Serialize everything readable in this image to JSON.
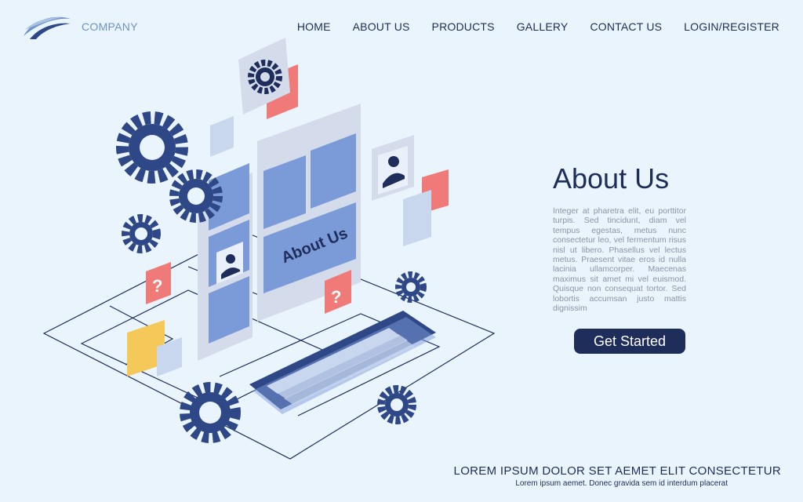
{
  "brand": {
    "name": "COMPANY",
    "logo_icon": "wave-logo-icon"
  },
  "nav": {
    "items": [
      {
        "label": "HOME"
      },
      {
        "label": "ABOUT US"
      },
      {
        "label": "PRODUCTS"
      },
      {
        "label": "GALLERY"
      },
      {
        "label": "CONTACT US"
      },
      {
        "label": "LOGIN/REGISTER"
      }
    ]
  },
  "illustration": {
    "label": "About Us",
    "icons": [
      "gear-icon",
      "user-icon",
      "question-icon",
      "keyboard-icon"
    ]
  },
  "hero": {
    "title": "About Us",
    "body": "Integer at pharetra elit, eu porttitor turpis. Sed tincidunt, diam vel tempus egestas, metus nunc consectetur leo, vel fermentum risus nisl ut libero. Phasellus vel lectus metus. Praesent vitae eros id nulla lacinia ullamcorper. Maecenas maximus sit amet mi vel euismod. Quisque non consequat tortor. Sed lobortis accumsan justo mattis dignissim",
    "cta_label": "Get Started"
  },
  "footer": {
    "heading": "LOREM IPSUM DOLOR SET AEMET ELIT CONSECTETUR",
    "subtext": "Lorem ipsum aemet. Donec gravida sem id interdum placerat"
  },
  "colors": {
    "background": "#eaf4fc",
    "navy": "#1e2d5a",
    "blue": "#7b9bd8",
    "dark_blue": "#2e4787",
    "coral": "#f07a78",
    "yellow": "#f5c85a",
    "grey_text": "#8a95a8"
  }
}
